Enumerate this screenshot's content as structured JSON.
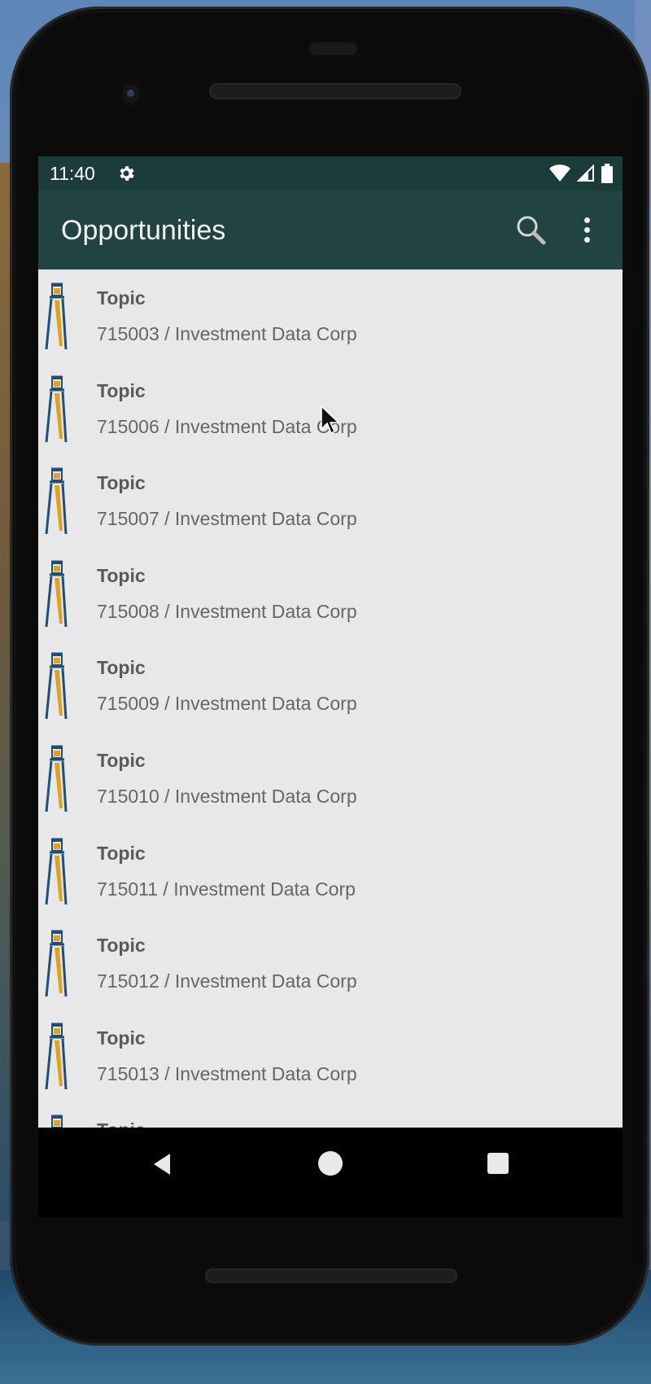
{
  "status_bar": {
    "time": "11:40"
  },
  "app_bar": {
    "title": "Opportunities",
    "search_icon": "search-icon",
    "more_icon": "more-vert-icon"
  },
  "list": {
    "items": [
      {
        "title": "Topic",
        "subtitle": "715003 / Investment Data Corp"
      },
      {
        "title": "Topic",
        "subtitle": "715006 / Investment Data Corp"
      },
      {
        "title": "Topic",
        "subtitle": "715007 / Investment Data Corp"
      },
      {
        "title": "Topic",
        "subtitle": "715008 / Investment Data Corp"
      },
      {
        "title": "Topic",
        "subtitle": "715009 / Investment Data Corp"
      },
      {
        "title": "Topic",
        "subtitle": "715010 / Investment Data Corp"
      },
      {
        "title": "Topic",
        "subtitle": "715011 / Investment Data Corp"
      },
      {
        "title": "Topic",
        "subtitle": "715012 / Investment Data Corp"
      },
      {
        "title": "Topic",
        "subtitle": "715013 / Investment Data Corp"
      },
      {
        "title": "Topic",
        "subtitle": ""
      }
    ]
  },
  "colors": {
    "status_bar_bg": "#1c3c3b",
    "app_bar_bg": "#214443",
    "list_bg": "#e8e8e8",
    "icon_navy": "#1f4e79",
    "icon_gold": "#e0a020"
  },
  "nav_bar": {
    "back_icon": "back-triangle-icon",
    "home_icon": "home-circle-icon",
    "recents_icon": "recents-square-icon"
  }
}
